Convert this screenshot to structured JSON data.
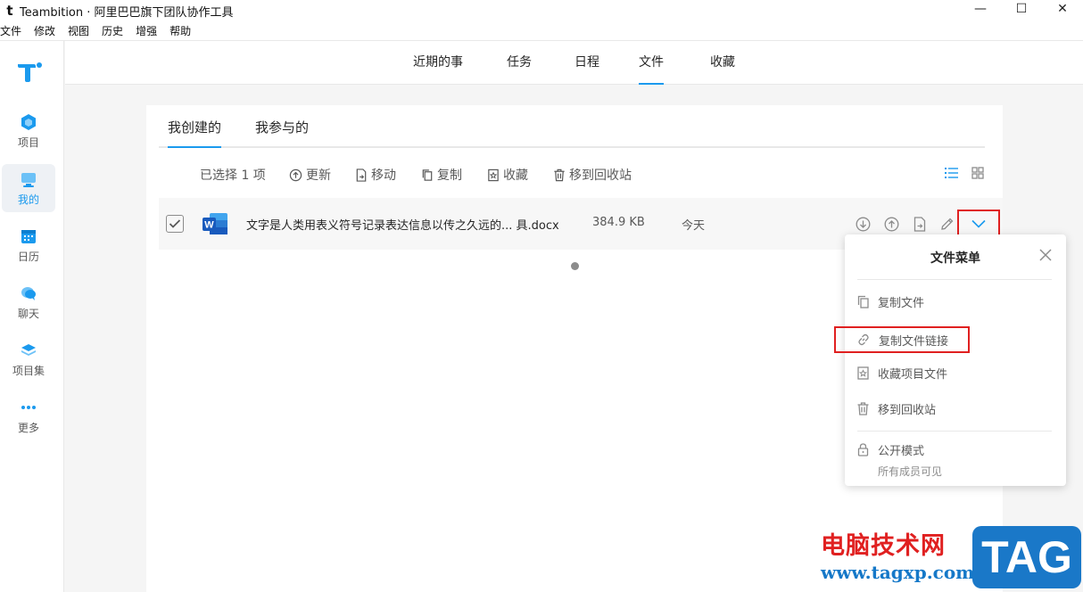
{
  "window": {
    "app_icon_letter": "t",
    "title": "Teambition · 阿里巴巴旗下团队协作工具",
    "minimize": "—",
    "maximize": "☐",
    "close": "✕"
  },
  "menubar": [
    "文件",
    "修改",
    "视图",
    "历史",
    "增强",
    "帮助"
  ],
  "sidebar": {
    "items": [
      {
        "label": "项目",
        "icon": "project-cube-icon"
      },
      {
        "label": "我的",
        "icon": "my-monitor-icon",
        "active": true
      },
      {
        "label": "日历",
        "icon": "calendar-icon"
      },
      {
        "label": "聊天",
        "icon": "chat-bubble-icon"
      },
      {
        "label": "项目集",
        "icon": "layers-icon"
      },
      {
        "label": "更多",
        "icon": "more-dots-icon"
      }
    ]
  },
  "topnav": {
    "tabs": [
      "近期的事",
      "任务",
      "日程",
      "文件",
      "收藏"
    ],
    "active": "文件"
  },
  "subtabs": {
    "created": "我创建的",
    "participated": "我参与的"
  },
  "toolbar": {
    "selected": "已选择 1 项",
    "update": "更新",
    "move": "移动",
    "copy": "复制",
    "favorite": "收藏",
    "trash": "移到回收站"
  },
  "file": {
    "word_badge": "W",
    "name": "文字是人类用表义符号记录表达信息以传之久远的... 具.docx",
    "size": "384.9 KB",
    "date": "今天"
  },
  "popup": {
    "title": "文件菜单",
    "items": {
      "copy_file": "复制文件",
      "copy_link": "复制文件链接",
      "favorite_project_file": "收藏项目文件",
      "move_to_trash": "移到回收站",
      "public_mode": "公开模式",
      "public_mode_desc": "所有成员可见"
    }
  },
  "watermark": {
    "site_name": "电脑技术网",
    "url": "www.tagxp.com",
    "tag": "TAG"
  },
  "colors": {
    "accent": "#1b9aee",
    "highlight_red": "#e02020",
    "word_blue": "#185abd"
  }
}
